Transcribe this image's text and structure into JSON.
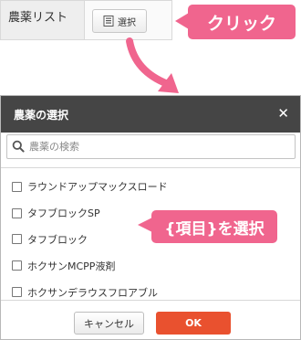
{
  "field": {
    "label": "農薬リスト",
    "select_button_label": "選択",
    "select_button_icon": "list-icon"
  },
  "annotations": {
    "click_callout": "クリック",
    "select_callout": "{項目}を選択",
    "color": "#f0658e"
  },
  "dialog": {
    "title": "農薬の選択",
    "close_icon": "close-icon",
    "search": {
      "placeholder": "農薬の検索",
      "value": "",
      "icon": "search-icon"
    },
    "items": [
      {
        "label": "ラウンドアップマックスロード",
        "checked": false
      },
      {
        "label": "タフブロックSP",
        "checked": false
      },
      {
        "label": "タフブロック",
        "checked": false
      },
      {
        "label": "ホクサンMCPP液剤",
        "checked": false
      },
      {
        "label": "ホクサンデラウスフロアブル",
        "checked": false
      }
    ],
    "cancel_label": "キャンセル",
    "ok_label": "OK",
    "header_color": "#454545",
    "ok_color": "#e9512f"
  }
}
